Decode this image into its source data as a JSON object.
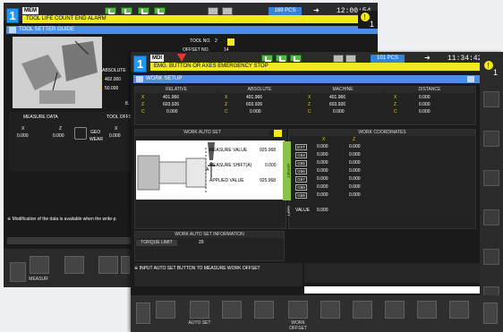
{
  "back": {
    "channel": "1",
    "mode": "MEM",
    "pcs": "169 PCS",
    "time": "12:00:54",
    "alarm": "TOOL LIFE COUNT END ALARM",
    "title": "TOOL SETTER GUIDE",
    "tool_no_label": "TOOL NO.",
    "tool_no": "2",
    "offset_no_label": "OFFSET NO.",
    "offset_no": "14",
    "absolute_label": "ABSOLUTE",
    "abs_x_label": "X",
    "abs_x": "402.000",
    "abs_z_label": "Z",
    "abs_z": "50.000",
    "measure_data": "MEASURE DATA",
    "tool_offset": "TOOL OFFS",
    "md_x_label": "X",
    "md_x": "0.000",
    "md_z_label": "Z",
    "md_z": "0.000",
    "geo": "GEO",
    "wear": "WEAR",
    "geo_x_label": "X",
    "geo_x": "0.000",
    "page": "8.",
    "note": "※ Modification of the data is available when the write-p",
    "measure_btn": "MEASUR"
  },
  "front": {
    "channel": "1",
    "mode": "MDI",
    "pcs": "101 PCS",
    "time": "11:34:42",
    "alarm": "EMG. BUTTON OR AXES EMERGENCY STOP",
    "title": "WORK SETUP",
    "coords": {
      "headers": [
        "RELATIVE",
        "ABSOLUTE",
        "MACHINE",
        "DISTANCE"
      ],
      "axes": [
        "X",
        "Z",
        "C"
      ],
      "values": [
        [
          "401.966",
          "603.926",
          "0.000"
        ],
        [
          "401.966",
          "603.926",
          "0.000"
        ],
        [
          "401.966",
          "603.926",
          "0.000"
        ],
        [
          "0.000",
          "0.000",
          "0.000"
        ]
      ]
    },
    "auto_set_title": "WORK AUTO SET",
    "measure_value_label": "MEASURE VALUE",
    "measure_value": "925.968",
    "measure_shift_label": "MEASURE SHIFT(A)",
    "measure_shift": "0.000",
    "applied_value_label": "APPLIED VALUE",
    "applied_value": "925.968",
    "shift_marker": "A",
    "work_coord_title": "WORK COORDINATES",
    "wc_col_x": "X",
    "wc_col_z": "Z",
    "offset_vertical": "OFFSET",
    "wc_rows": [
      {
        "code": "EXT",
        "x": "0.000",
        "z": "0.000"
      },
      {
        "code": "G54",
        "x": "0.000",
        "z": "0.000"
      },
      {
        "code": "G55",
        "x": "0.000",
        "z": "0.000"
      },
      {
        "code": "G56",
        "x": "0.000",
        "z": "0.000"
      },
      {
        "code": "G57",
        "x": "0.000",
        "z": "0.000"
      },
      {
        "code": "G58",
        "x": "0.000",
        "z": "0.000"
      },
      {
        "code": "G59",
        "x": "0.000",
        "z": "0.000"
      }
    ],
    "shift_vertical": "SHIFT",
    "shift_value_label": "VALUE",
    "shift_value": "0.000",
    "info_title": "WORK AUTO SET INFORMATION",
    "torque_label": "TORQUE LIMIT",
    "torque_value": "20",
    "msg": "※ INPUT AUTO SET BUTTON TO MEASURE WORK OFFSET",
    "btn_auto_set": "AUTO SET",
    "btn_work_offset": "WORK OFFSET"
  }
}
